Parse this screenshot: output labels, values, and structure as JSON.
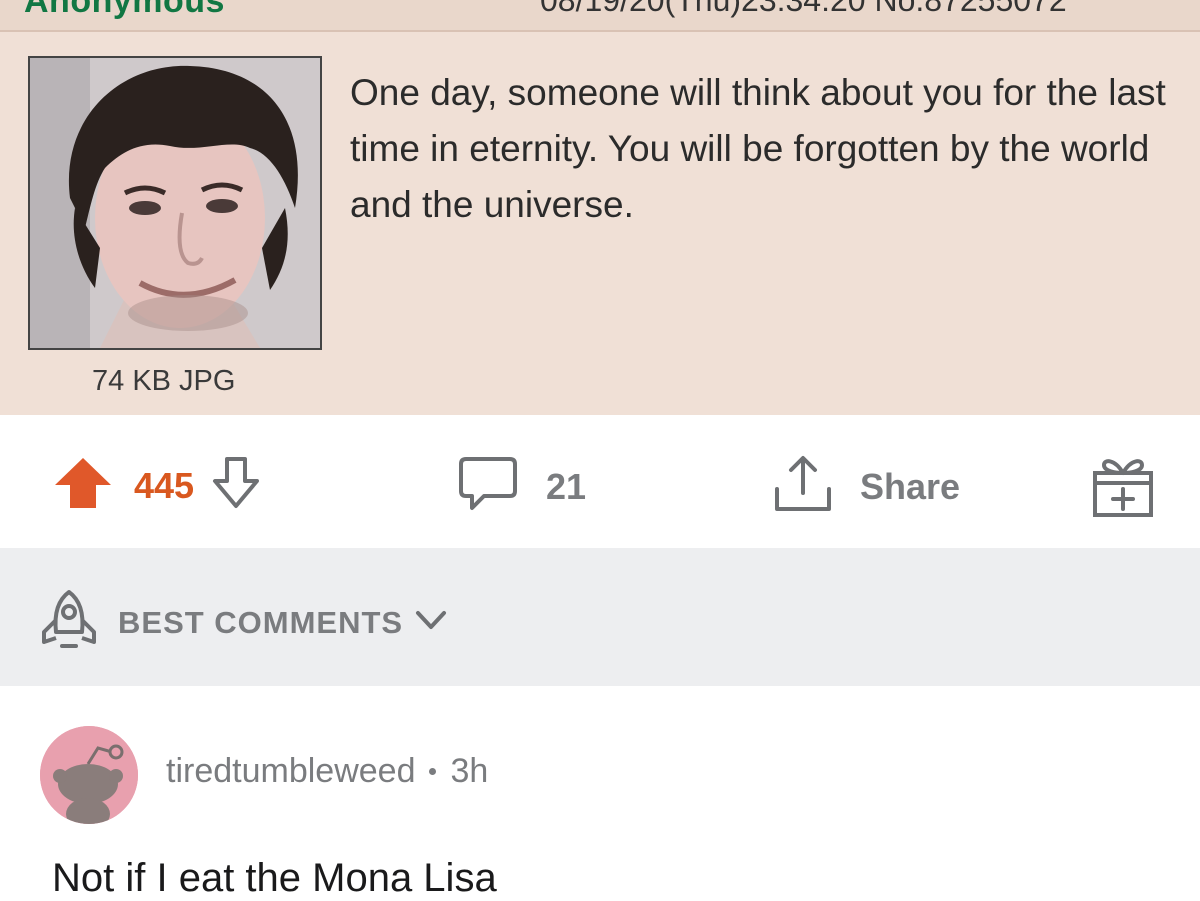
{
  "chan_post": {
    "name": "Anonymous",
    "meta": "08/19/20(Thu)23:34:20 No.87255072",
    "text": "One day, someone will think about you for the last time in eternity. You will be forgotten by the world and the universe.",
    "file_info": "74 KB JPG"
  },
  "actions": {
    "upvotes": "445",
    "comments": "21",
    "share_label": "Share",
    "vote_color": "#d9581f"
  },
  "sort": {
    "label": "BEST COMMENTS"
  },
  "comment": {
    "username": "tiredtumbleweed",
    "age": "3h",
    "body": "Not if I eat the Mona Lisa",
    "avatar_color": "#e8a0ae"
  },
  "icons": {
    "upvote": "upvote-arrow-icon",
    "downvote": "downvote-arrow-icon",
    "comment": "comment-bubble-icon",
    "share": "share-upload-icon",
    "award": "gift-award-icon",
    "sort": "rocket-icon",
    "chevron": "chevron-down-icon"
  }
}
